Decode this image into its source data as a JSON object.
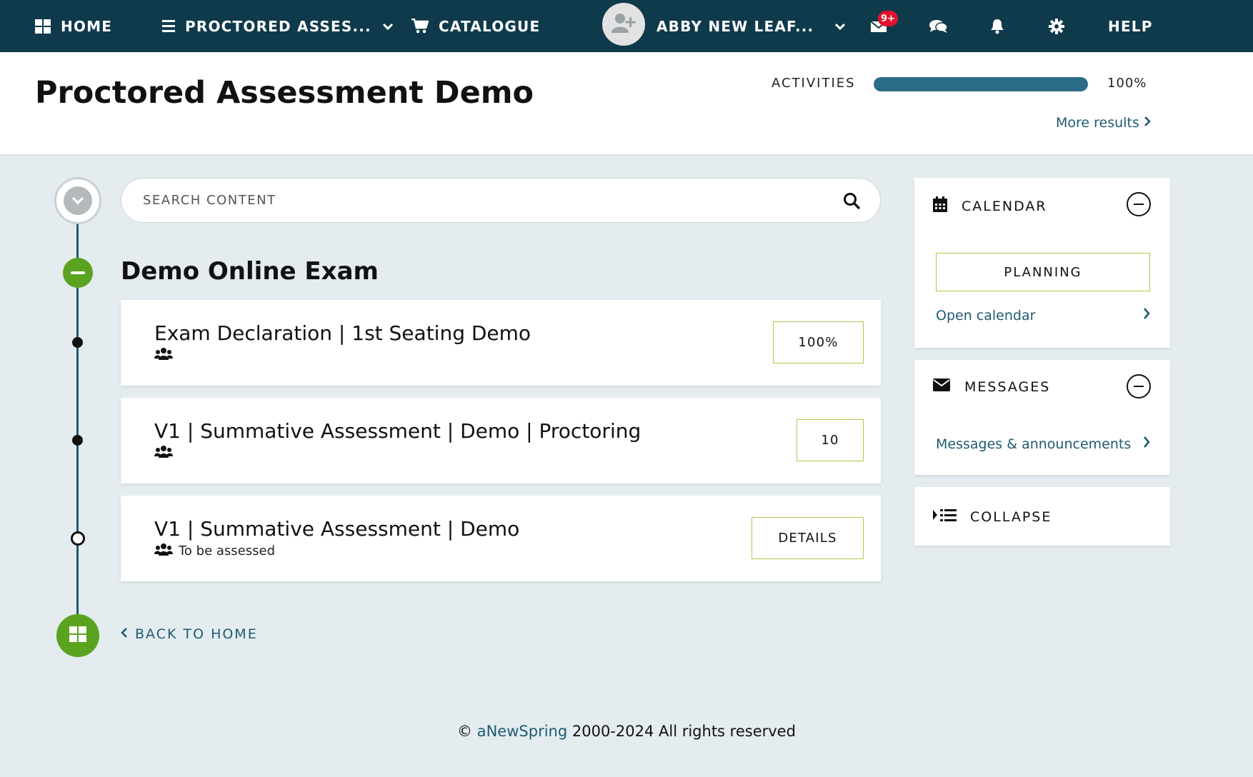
{
  "nav": {
    "home": "HOME",
    "course": "PROCTORED ASSES...",
    "catalogue": "CATALOGUE",
    "user": "ABBY NEW LEAF...",
    "mail_badge": "9+",
    "help": "HELP"
  },
  "header": {
    "title": "Proctored Assessment Demo",
    "activities_label": "ACTIVITIES",
    "activities_progress": 100,
    "activities_value": "100%",
    "more_results": "More results"
  },
  "search": {
    "placeholder": "SEARCH CONTENT"
  },
  "section": {
    "title": "Demo Online Exam",
    "items": [
      {
        "title": "Exam Declaration | 1st Seating Demo",
        "meta": "",
        "button": "100%"
      },
      {
        "title": "V1 | Summative Assessment | Demo | Proctoring",
        "meta": "",
        "button": "10"
      },
      {
        "title": "V1 | Summative Assessment | Demo",
        "meta": "To be assessed",
        "button": "DETAILS"
      }
    ]
  },
  "back_home": "BACK TO HOME",
  "sidebar": {
    "calendar": {
      "title": "CALENDAR",
      "planning": "PLANNING",
      "link": "Open calendar"
    },
    "messages": {
      "title": "MESSAGES",
      "link": "Messages & announcements"
    },
    "collapse": {
      "title": "COLLAPSE"
    }
  },
  "footer": {
    "prefix": "© ",
    "brand": "aNewSpring",
    "suffix": " 2000-2024 All rights reserved"
  },
  "colors": {
    "nav_bg": "#0f3a4b",
    "accent_blue": "#1f5a73",
    "accent_green": "#5aa31e",
    "badge_red": "#e0122d",
    "button_border": "#b7c64b"
  }
}
